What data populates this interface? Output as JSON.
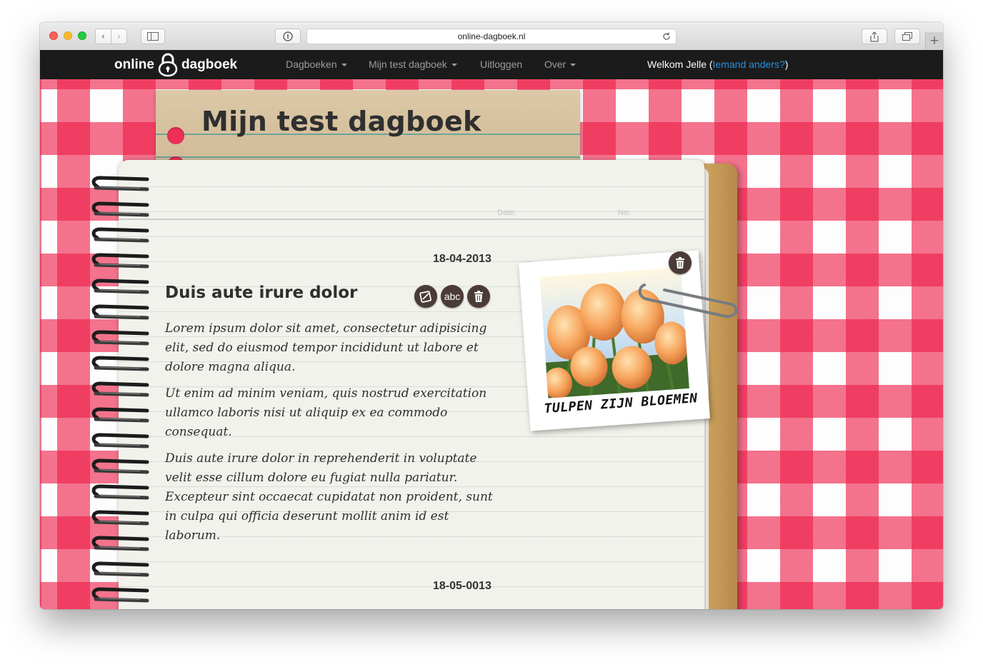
{
  "browser": {
    "url": "online-dagboek.nl",
    "back_icon": "‹",
    "forward_icon": "›",
    "new_tab_icon": "+"
  },
  "site": {
    "logo_left": "online",
    "logo_right": "dagboek",
    "nav": {
      "dagboeken": "Dagboeken",
      "mijn_test_dagboek": "Mijn test dagboek",
      "uitloggen": "Uitloggen",
      "over": "Over"
    },
    "welcome_prefix": "Welkom Jelle (",
    "welcome_link": "Iemand anders?",
    "welcome_suffix": ")"
  },
  "diary": {
    "title": "Mijn test dagboek",
    "date_label": "Date:",
    "no_label": "No:",
    "entries": [
      {
        "date": "18-04-2013",
        "title": "Duis aute irure dolor",
        "paragraphs": [
          "Lorem ipsum dolor sit amet, consectetur adipisicing elit, sed do eiusmod tempor incididunt ut labore et dolore magna aliqua.",
          "Ut enim ad minim veniam, quis nostrud exercitation ullamco laboris nisi ut aliquip ex ea commodo consequat.",
          "Duis aute irure dolor in reprehenderit in voluptate velit esse cillum dolore eu fugiat nulla pariatur. Excepteur sint occaecat cupidatat non proident, sunt in culpa qui officia deserunt mollit anim id est laborum."
        ],
        "actions": {
          "edit_icon": "edit-icon",
          "spellcheck_label": "abc",
          "delete_icon": "trash-icon"
        }
      },
      {
        "date": "18-05-0013"
      }
    ],
    "photo": {
      "caption": "TULPEN ZIJN BLOEMEN",
      "subject": "tulips"
    }
  },
  "colors": {
    "navbar": "#1b1b1b",
    "link": "#2a8fd8",
    "tablecloth_red": "#ee1e48",
    "button_brown": "#4b3b36"
  }
}
